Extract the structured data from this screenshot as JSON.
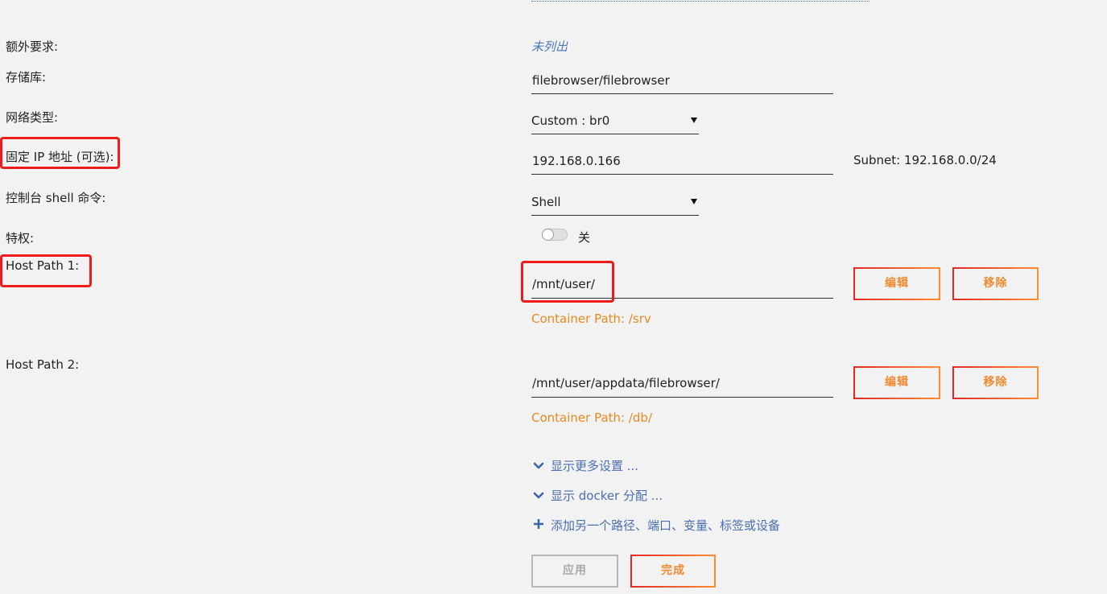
{
  "labels": {
    "extra_requirements": "额外要求:",
    "repository": "存储库:",
    "network_type": "网络类型:",
    "fixed_ip": "固定 IP 地址 (可选):",
    "console_shell": "控制台 shell 命令:",
    "privileged": "特权:",
    "host_path_1": "Host Path 1:",
    "host_path_2": "Host Path 2:"
  },
  "values": {
    "extra_requirements": "未列出",
    "repository": "filebrowser/filebrowser",
    "network_type": "Custom : br0",
    "fixed_ip": "192.168.0.166",
    "subnet": "Subnet: 192.168.0.0/24",
    "console_shell": "Shell",
    "privileged_state": "关",
    "host_path_1": "/mnt/user/",
    "container_path_1": "Container Path: /srv",
    "host_path_2": "/mnt/user/appdata/filebrowser/",
    "container_path_2": "Container Path: /db/"
  },
  "buttons": {
    "edit": "编辑",
    "remove": "移除",
    "apply": "应用",
    "done": "完成"
  },
  "links": {
    "show_more_settings": "显示更多设置 ...",
    "show_docker_allocation": "显示 docker 分配 ...",
    "add_another": "添加另一个路径、端口、变量、标签或设备"
  },
  "colors": {
    "background": "#f2f2f2",
    "accent_orange": "#f08a30",
    "accent_red": "#e22828",
    "link_blue": "#4a6fb0",
    "highlight_box": "#ee1c1c"
  },
  "icons": {
    "network_dropdown": "caret-down-icon",
    "shell_dropdown": "caret-down-icon",
    "show_more": "chevron-down-icon",
    "show_docker": "chevron-down-icon",
    "add": "plus-icon"
  }
}
